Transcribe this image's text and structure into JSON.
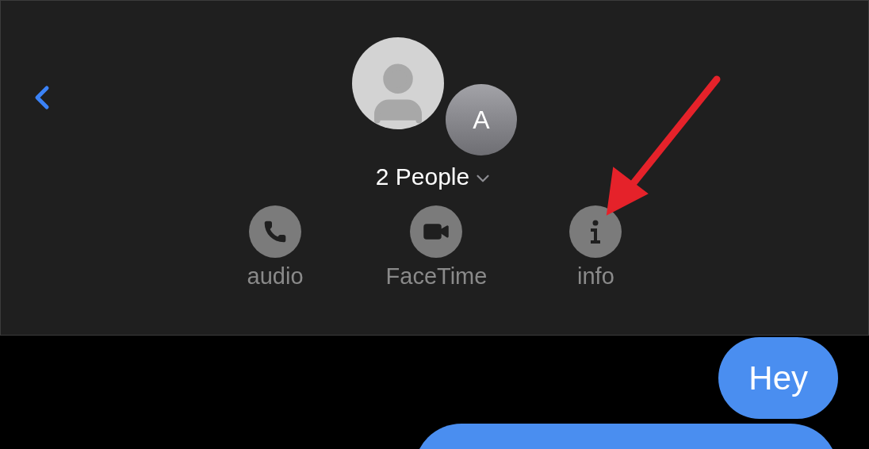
{
  "header": {
    "avatars": [
      {
        "kind": "silhouette"
      },
      {
        "kind": "initial",
        "initial": "A"
      }
    ],
    "title": "2 People",
    "actions": [
      {
        "kind": "phone",
        "label": "audio"
      },
      {
        "kind": "video",
        "label": "FaceTime"
      },
      {
        "kind": "info",
        "label": "info"
      }
    ]
  },
  "annotation": {
    "kind": "arrow"
  },
  "messages": [
    {
      "kind": "text",
      "text": "Hey"
    },
    {
      "kind": "cut_off"
    }
  ]
}
